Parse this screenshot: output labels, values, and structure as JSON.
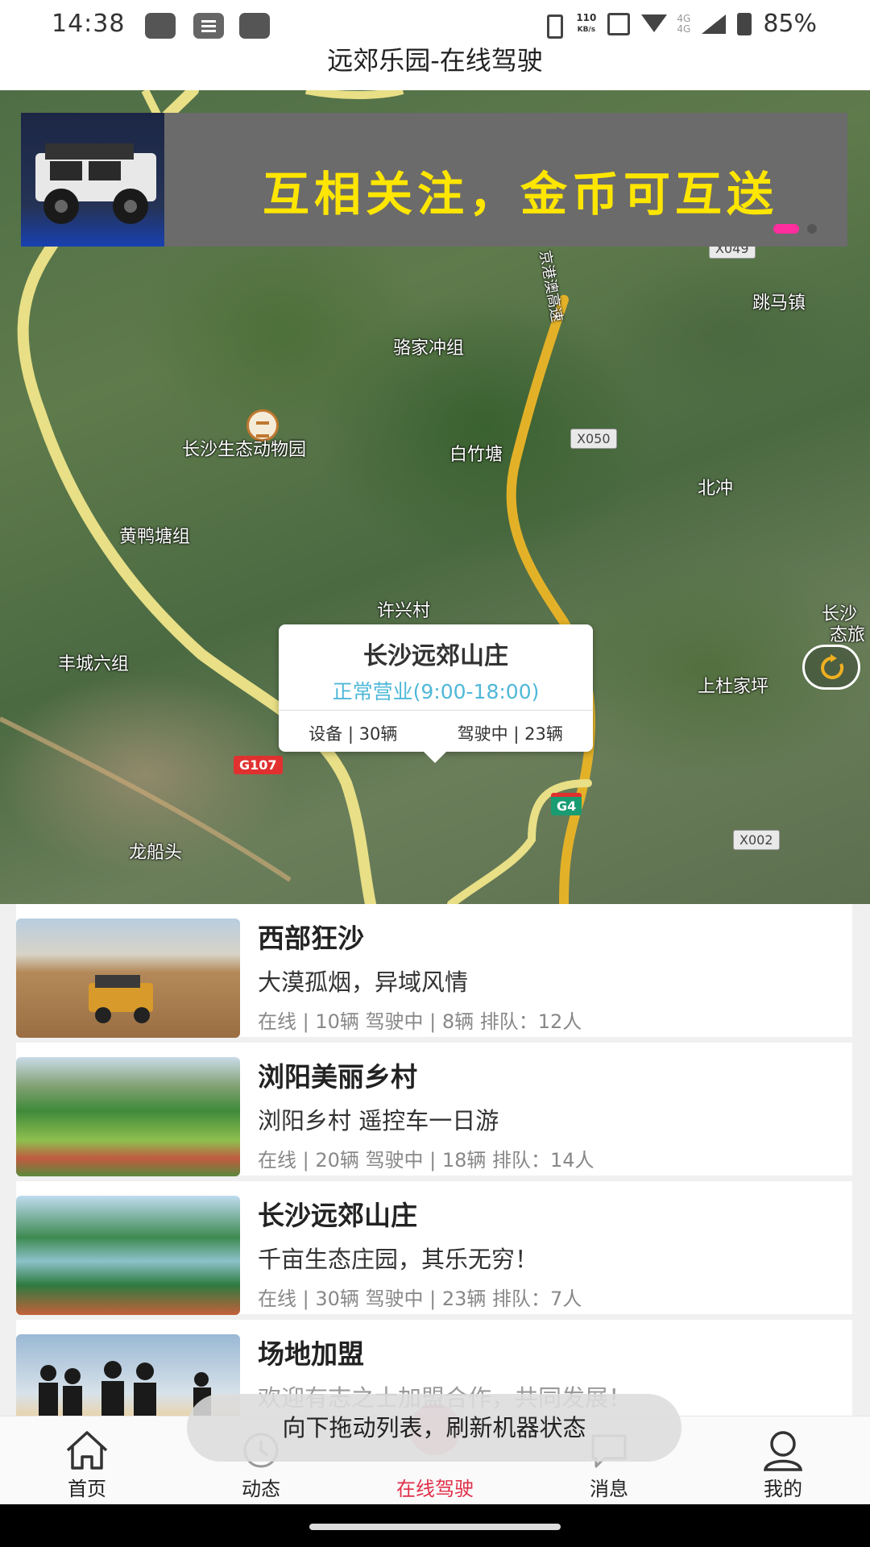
{
  "status_bar": {
    "time": "14:38",
    "net_speed_top": "110",
    "net_speed_unit": "KB/s",
    "net_type_1": "4G",
    "net_type_2": "4G",
    "battery": "85%"
  },
  "page_title": "远郊乐园-在线驾驶",
  "banner": {
    "text": "互相关注，金币可互送",
    "active_index": 0,
    "dot_count": 2
  },
  "map": {
    "labels": {
      "luojia": "骆家冲组",
      "zoo": "长沙生态动物园",
      "baizhu": "白竹塘",
      "tiaoma": "跳马镇",
      "beichong": "北冲",
      "huangya": "黄鸭塘组",
      "xuxing": "许兴村",
      "fengcheng": "丰城六组",
      "shangdu": "上杜家坪",
      "longchuan": "龙船头",
      "changsha_edge": "长沙",
      "edge2": "态旅"
    },
    "road_tags": {
      "x050": "X050",
      "x049": "X049",
      "g107": "G107",
      "g4": "G4",
      "x002": "X002",
      "jingzhu": "京港澳高速"
    },
    "popup": {
      "name": "长沙远郊山庄",
      "hours": "正常营业(9:00-18:00)",
      "devices": "设备 | 30辆",
      "driving": "驾驶中 | 23辆"
    }
  },
  "venues": [
    {
      "title": "西部狂沙",
      "subtitle": "大漠孤烟，异域风情",
      "stats": "在线 | 10辆  驾驶中 | 8辆  排队：12人"
    },
    {
      "title": "浏阳美丽乡村",
      "subtitle": "浏阳乡村  遥控车一日游",
      "stats": "在线 | 20辆  驾驶中 | 18辆  排队：14人"
    },
    {
      "title": "长沙远郊山庄",
      "subtitle": "千亩生态庄园，其乐无穷！",
      "stats": "在线 | 30辆  驾驶中 | 23辆  排队：7人"
    },
    {
      "title": "场地加盟",
      "subtitle": "欢迎有志之士加盟合作，共同发展！",
      "stats": ""
    }
  ],
  "toast": "向下拖动列表，刷新机器状态",
  "nav": {
    "home": "首页",
    "feed": "动态",
    "drive": "在线驾驶",
    "messages": "消息",
    "me": "我的"
  },
  "colors": {
    "accent": "#e0304a",
    "banner_text": "#ffe600",
    "hours_text": "#4fb8d8",
    "active_dot": "#ff2d9d"
  }
}
